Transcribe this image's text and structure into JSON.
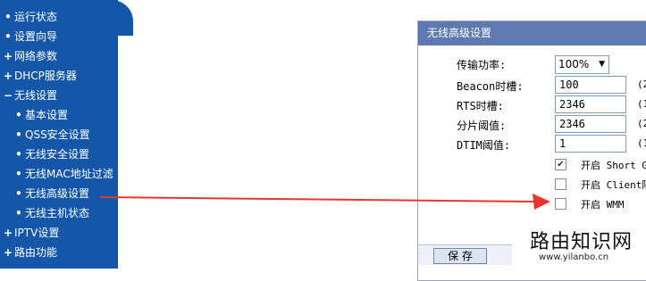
{
  "sidebar": {
    "items": [
      {
        "marker": "•",
        "label": "运行状态"
      },
      {
        "marker": "•",
        "label": "设置向导"
      },
      {
        "marker": "+",
        "label": "网络参数"
      },
      {
        "marker": "+",
        "label": "DHCP服务器"
      },
      {
        "marker": "−",
        "label": "无线设置"
      },
      {
        "marker": "•",
        "label": "基本设置"
      },
      {
        "marker": "•",
        "label": "QSS安全设置"
      },
      {
        "marker": "•",
        "label": "无线安全设置"
      },
      {
        "marker": "•",
        "label": "无线MAC地址过滤"
      },
      {
        "marker": "•",
        "label": "无线高级设置"
      },
      {
        "marker": "•",
        "label": "无线主机状态"
      },
      {
        "marker": "+",
        "label": "IPTV设置"
      },
      {
        "marker": "+",
        "label": "路由功能"
      }
    ]
  },
  "dialog": {
    "title": "无线高级设置",
    "tx_power": {
      "label": "传输功率:",
      "value": "100%"
    },
    "beacon": {
      "label": "Beacon时槽:",
      "value": "100",
      "hint": "(2"
    },
    "rts": {
      "label": "RTS时槽:",
      "value": "2346",
      "hint": "(1"
    },
    "frag": {
      "label": "分片阈值:",
      "value": "2346",
      "hint": "(2"
    },
    "dtim": {
      "label": "DTIM阈值:",
      "value": "1",
      "hint": "(1"
    },
    "options": [
      {
        "label": "开启 Short G",
        "checked": true
      },
      {
        "label": "开启 Client隔",
        "checked": false
      },
      {
        "label": "开启 WMM",
        "checked": false
      }
    ],
    "save_label": "保 存"
  },
  "watermark": {
    "title": "路由知识网",
    "url": "www.yilanbo.cn"
  },
  "colors": {
    "sidebar_bg": "#1457a8",
    "dialog_header": "#5e7ab0",
    "arrow": "#e8352e"
  }
}
